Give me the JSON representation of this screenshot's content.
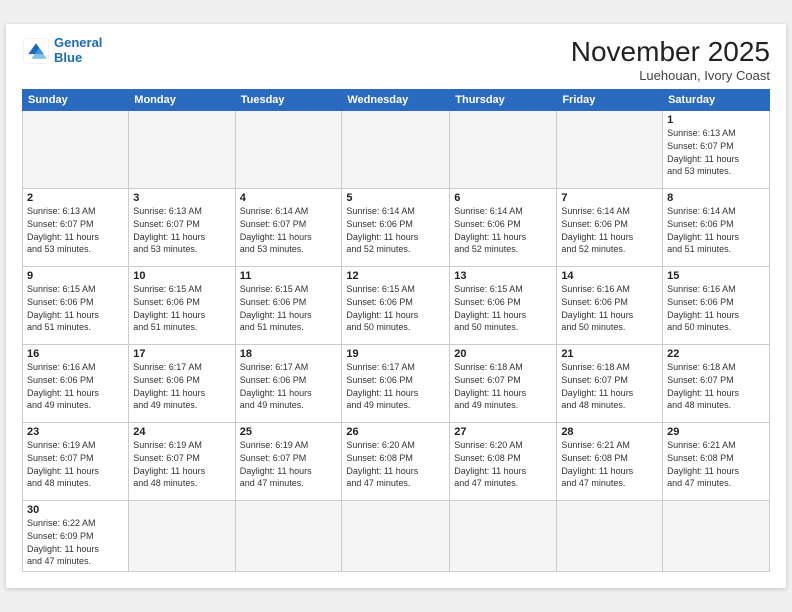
{
  "header": {
    "logo_line1": "General",
    "logo_line2": "Blue",
    "month": "November 2025",
    "location": "Luehouan, Ivory Coast"
  },
  "weekdays": [
    "Sunday",
    "Monday",
    "Tuesday",
    "Wednesday",
    "Thursday",
    "Friday",
    "Saturday"
  ],
  "weeks": [
    [
      {
        "day": "",
        "empty": true
      },
      {
        "day": "",
        "empty": true
      },
      {
        "day": "",
        "empty": true
      },
      {
        "day": "",
        "empty": true
      },
      {
        "day": "",
        "empty": true
      },
      {
        "day": "",
        "empty": true
      },
      {
        "day": "1",
        "sunrise": "6:13 AM",
        "sunset": "6:07 PM",
        "daylight": "11 hours and 53 minutes."
      }
    ],
    [
      {
        "day": "2",
        "sunrise": "6:13 AM",
        "sunset": "6:07 PM",
        "daylight": "11 hours and 53 minutes."
      },
      {
        "day": "3",
        "sunrise": "6:13 AM",
        "sunset": "6:07 PM",
        "daylight": "11 hours and 53 minutes."
      },
      {
        "day": "4",
        "sunrise": "6:14 AM",
        "sunset": "6:07 PM",
        "daylight": "11 hours and 53 minutes."
      },
      {
        "day": "5",
        "sunrise": "6:14 AM",
        "sunset": "6:06 PM",
        "daylight": "11 hours and 52 minutes."
      },
      {
        "day": "6",
        "sunrise": "6:14 AM",
        "sunset": "6:06 PM",
        "daylight": "11 hours and 52 minutes."
      },
      {
        "day": "7",
        "sunrise": "6:14 AM",
        "sunset": "6:06 PM",
        "daylight": "11 hours and 52 minutes."
      },
      {
        "day": "8",
        "sunrise": "6:14 AM",
        "sunset": "6:06 PM",
        "daylight": "11 hours and 51 minutes."
      }
    ],
    [
      {
        "day": "9",
        "sunrise": "6:15 AM",
        "sunset": "6:06 PM",
        "daylight": "11 hours and 51 minutes."
      },
      {
        "day": "10",
        "sunrise": "6:15 AM",
        "sunset": "6:06 PM",
        "daylight": "11 hours and 51 minutes."
      },
      {
        "day": "11",
        "sunrise": "6:15 AM",
        "sunset": "6:06 PM",
        "daylight": "11 hours and 51 minutes."
      },
      {
        "day": "12",
        "sunrise": "6:15 AM",
        "sunset": "6:06 PM",
        "daylight": "11 hours and 50 minutes."
      },
      {
        "day": "13",
        "sunrise": "6:15 AM",
        "sunset": "6:06 PM",
        "daylight": "11 hours and 50 minutes."
      },
      {
        "day": "14",
        "sunrise": "6:16 AM",
        "sunset": "6:06 PM",
        "daylight": "11 hours and 50 minutes."
      },
      {
        "day": "15",
        "sunrise": "6:16 AM",
        "sunset": "6:06 PM",
        "daylight": "11 hours and 50 minutes."
      }
    ],
    [
      {
        "day": "16",
        "sunrise": "6:16 AM",
        "sunset": "6:06 PM",
        "daylight": "11 hours and 49 minutes."
      },
      {
        "day": "17",
        "sunrise": "6:17 AM",
        "sunset": "6:06 PM",
        "daylight": "11 hours and 49 minutes."
      },
      {
        "day": "18",
        "sunrise": "6:17 AM",
        "sunset": "6:06 PM",
        "daylight": "11 hours and 49 minutes."
      },
      {
        "day": "19",
        "sunrise": "6:17 AM",
        "sunset": "6:06 PM",
        "daylight": "11 hours and 49 minutes."
      },
      {
        "day": "20",
        "sunrise": "6:18 AM",
        "sunset": "6:07 PM",
        "daylight": "11 hours and 49 minutes."
      },
      {
        "day": "21",
        "sunrise": "6:18 AM",
        "sunset": "6:07 PM",
        "daylight": "11 hours and 48 minutes."
      },
      {
        "day": "22",
        "sunrise": "6:18 AM",
        "sunset": "6:07 PM",
        "daylight": "11 hours and 48 minutes."
      }
    ],
    [
      {
        "day": "23",
        "sunrise": "6:19 AM",
        "sunset": "6:07 PM",
        "daylight": "11 hours and 48 minutes."
      },
      {
        "day": "24",
        "sunrise": "6:19 AM",
        "sunset": "6:07 PM",
        "daylight": "11 hours and 48 minutes."
      },
      {
        "day": "25",
        "sunrise": "6:19 AM",
        "sunset": "6:07 PM",
        "daylight": "11 hours and 47 minutes."
      },
      {
        "day": "26",
        "sunrise": "6:20 AM",
        "sunset": "6:08 PM",
        "daylight": "11 hours and 47 minutes."
      },
      {
        "day": "27",
        "sunrise": "6:20 AM",
        "sunset": "6:08 PM",
        "daylight": "11 hours and 47 minutes."
      },
      {
        "day": "28",
        "sunrise": "6:21 AM",
        "sunset": "6:08 PM",
        "daylight": "11 hours and 47 minutes."
      },
      {
        "day": "29",
        "sunrise": "6:21 AM",
        "sunset": "6:08 PM",
        "daylight": "11 hours and 47 minutes."
      }
    ],
    [
      {
        "day": "30",
        "sunrise": "6:22 AM",
        "sunset": "6:09 PM",
        "daylight": "11 hours and 47 minutes."
      },
      {
        "day": "",
        "empty": true
      },
      {
        "day": "",
        "empty": true
      },
      {
        "day": "",
        "empty": true
      },
      {
        "day": "",
        "empty": true
      },
      {
        "day": "",
        "empty": true
      },
      {
        "day": "",
        "empty": true
      }
    ]
  ],
  "labels": {
    "sunrise": "Sunrise:",
    "sunset": "Sunset:",
    "daylight": "Daylight:"
  }
}
